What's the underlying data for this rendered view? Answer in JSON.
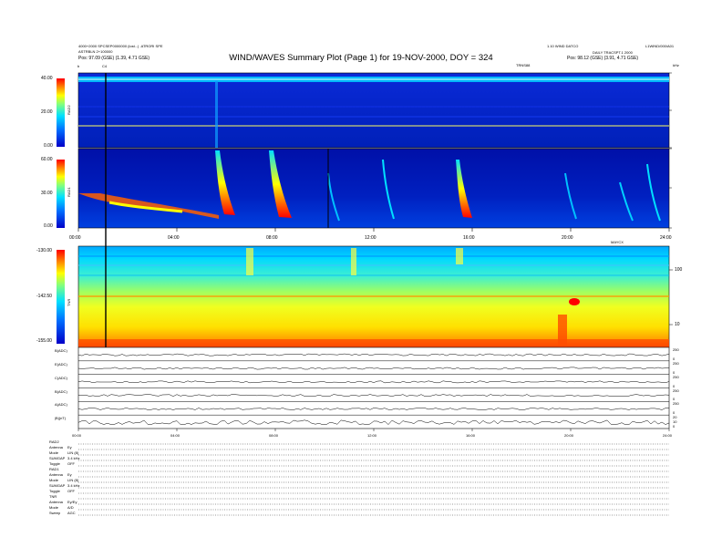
{
  "title": "WIND/WAVES Summary Plot (Page 1) for 19-NOV-2000, DOY = 324",
  "header": {
    "left": [
      "4000+2000 SPCSEP0000000 (lost...) .ATRORI SPE",
      "ASTRBLN 2+100000",
      "Pos: 97.09 (GSE) (1.39, 4.71 GSE)"
    ],
    "right": [
      "1.10 WIND DATCO",
      "DAILY TRACSPT.1 2000",
      "Pos: 98.12 (GSE) (3.91, 4.71 GSE)"
    ],
    "right_top": "L1WIND/000/A01",
    "mid": "TRNS88",
    "khz": "kHz"
  },
  "event_markers": {
    "b_label": "b",
    "c_label": "C4"
  },
  "panels": {
    "rad2": {
      "label": "RAD2",
      "ticks": [
        "40.00",
        "20.00",
        "0.00"
      ]
    },
    "rad1": {
      "label": "RAD1",
      "ticks": [
        "60.00",
        "30.00",
        "0.00"
      ]
    },
    "tnr": {
      "label": "TNR",
      "ticks": [
        "-130.00",
        "-142.50",
        "-155.00"
      ],
      "right_ticks": [
        "100",
        "10"
      ]
    }
  },
  "time_axis": {
    "ticks": [
      "00:00",
      "04:00",
      "08:00",
      "12:00",
      "16:00",
      "20:00",
      "24:00"
    ],
    "unit_label": "MAYCX"
  },
  "line_plots": [
    {
      "label": "B(ADC)",
      "scale": [
        "250",
        "0"
      ]
    },
    {
      "label": "E(ADC)",
      "scale": [
        "250",
        "0"
      ]
    },
    {
      "label": "C(ADC)",
      "scale": [
        "250",
        "0"
      ]
    },
    {
      "label": "B(ADC)",
      "scale": [
        "250",
        "0"
      ]
    },
    {
      "label": "A(ADC)",
      "scale": [
        "250",
        "0"
      ]
    },
    {
      "label": "|B|(nT)",
      "scale": [
        "20",
        "10",
        "0"
      ]
    }
  ],
  "bottom_ticks": [
    "00:00",
    "04:00",
    "08:00",
    "12:00",
    "16:00",
    "20:00",
    "24:00"
  ],
  "status_table": {
    "rad2": {
      "head": "RAD2",
      "rows": [
        [
          "Antenna",
          "Ey"
        ],
        [
          "Mode",
          "LIN (8)"
        ],
        [
          "SUMGAP",
          "3.4 kHz"
        ],
        [
          "Toggle",
          "OFF"
        ]
      ]
    },
    "rad1": {
      "head": "RAD1",
      "rows": [
        [
          "Antenna",
          "Ey"
        ],
        [
          "Mode",
          "LIN (8)"
        ],
        [
          "SUMGAP",
          "3.4 kHz"
        ],
        [
          "Toggle",
          "OFF"
        ]
      ]
    },
    "tnr": {
      "head": "TNR",
      "rows": [
        [
          "Antenna",
          "Ey/Ey"
        ],
        [
          "Mode",
          "A/D"
        ],
        [
          "Sweep",
          "AGC"
        ]
      ]
    }
  },
  "colors": {
    "low": "#0000c8",
    "mid": "#00e0ff",
    "midhi": "#ffff00",
    "high": "#ff0000"
  },
  "chart_data": [
    {
      "type": "heatmap",
      "title": "RAD2",
      "ylabel": "RAD2",
      "xlabel": "",
      "ylim": [
        0,
        40
      ],
      "xlim": [
        "00:00",
        "24:00"
      ],
      "colorbar": [
        "0.00",
        "20.00",
        "40.00"
      ]
    },
    {
      "type": "heatmap",
      "title": "RAD1",
      "ylabel": "RAD1",
      "xlabel": "",
      "ylim": [
        0,
        60
      ],
      "xlim": [
        "00:00",
        "24:00"
      ],
      "colorbar": [
        "0.00",
        "30.00",
        "60.00"
      ]
    },
    {
      "type": "heatmap",
      "title": "TNR",
      "ylabel": "TNR",
      "xlabel": "",
      "ylim": [
        -155,
        -130
      ],
      "xlim": [
        "00:00",
        "24:00"
      ],
      "colorbar": [
        "-155.00",
        "-142.50",
        "-130.00"
      ],
      "right_axis": [
        "10",
        "100"
      ]
    },
    {
      "type": "line",
      "series": [
        {
          "name": "B(ADC)"
        },
        {
          "name": "E(ADC)"
        },
        {
          "name": "C(ADC)"
        },
        {
          "name": "B(ADC)"
        },
        {
          "name": "A(ADC)"
        },
        {
          "name": "|B|(nT)"
        }
      ],
      "xlim": [
        "00:00",
        "24:00"
      ]
    }
  ]
}
